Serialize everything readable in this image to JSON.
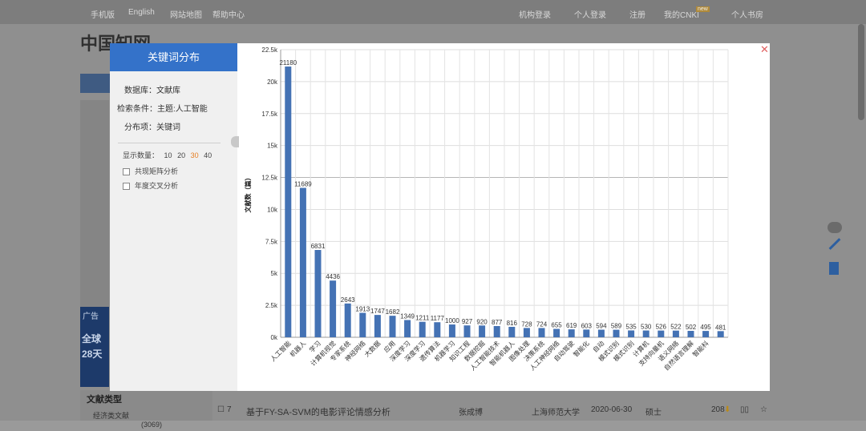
{
  "topbar": {
    "links": [
      "手机版",
      "English",
      "网站地图",
      "帮助中心"
    ],
    "right": [
      "机构登录",
      "个人登录",
      "注册",
      "我的CNKI",
      "个人书房"
    ],
    "new_badge": "new"
  },
  "logo": "中国知网",
  "ad_label": "广告",
  "ad_lines": [
    "全球",
    "28天"
  ],
  "left_heading": "文献类型",
  "left_item": "经济类文献",
  "left_item_count": "(3069)",
  "bottom_row": {
    "index": "7",
    "title": "基于FY-SA-SVM的电影评论情感分析",
    "author": "张成博",
    "source": "上海师范大学",
    "date": "2020-06-30",
    "type": "硕士",
    "downloads": "208"
  },
  "modal": {
    "title": "关键词分布",
    "database_label": "数据库：文献库",
    "condition_label": "检索条件：主题:人工智能",
    "field_label": "分布项：关键词",
    "count_label": "显示数量：",
    "count_options": [
      "10",
      "20",
      "30",
      "40"
    ],
    "count_selected": "30",
    "options": [
      "共现矩阵分析",
      "年度交叉分析"
    ],
    "close_symbol": "✕"
  },
  "chart_data": {
    "type": "bar",
    "ylabel": "文献数（篇）",
    "ylim": [
      0,
      22500
    ],
    "yticks": [
      "0k",
      "2.5k",
      "5k",
      "7.5k",
      "10k",
      "12.5k",
      "15k",
      "17.5k",
      "20k",
      "22.5k"
    ],
    "grid": true,
    "bar_color": "#4472b4",
    "categories": [
      "人工智能",
      "机器人",
      "学习",
      "计算机视觉",
      "专家系统",
      "神经网络",
      "大数据",
      "应用",
      "深度学习",
      "深度学习",
      "遗传算法",
      "机器学习",
      "知识工程",
      "数据挖掘",
      "人工智能技术",
      "智能机器人",
      "图像处理",
      "决策系统",
      "人工神经网络",
      "自动驾驶",
      "智能化",
      "自动",
      "模式识别",
      "模式识别",
      "计算机",
      "支持向量机",
      "语义网络",
      "自然语言理解",
      "智能科"
    ],
    "values": [
      21180,
      11689,
      6831,
      4436,
      2643,
      1913,
      1747,
      1682,
      1349,
      1211,
      1177,
      1000,
      927,
      920,
      877,
      816,
      728,
      724,
      655,
      619,
      603,
      594,
      589,
      535,
      530,
      526,
      522,
      502,
      495,
      481
    ],
    "value_labels": [
      "21180",
      "11689",
      "6831",
      "4436",
      "2643",
      "1913",
      "1747",
      "1682",
      "1349",
      "1211",
      "1177",
      "1000",
      "927",
      "920",
      "877",
      "816",
      "728",
      "724",
      "655",
      "619",
      "603",
      "594",
      "589",
      "535",
      "530",
      "526",
      "522",
      "502",
      "495",
      "481"
    ]
  }
}
